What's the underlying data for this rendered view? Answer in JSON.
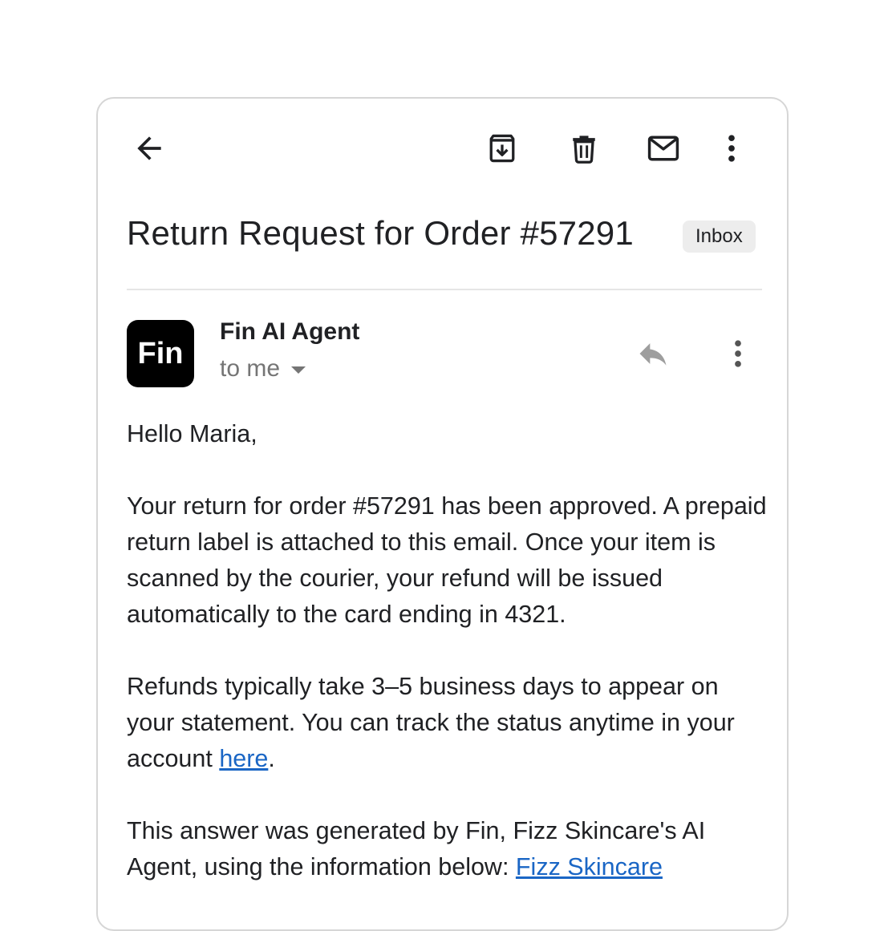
{
  "toolbar": {
    "back_icon": "back-arrow-icon",
    "archive_icon": "archive-icon",
    "delete_icon": "trash-icon",
    "mail_icon": "mail-icon",
    "more_icon": "more-vertical-icon"
  },
  "email": {
    "subject": "Return Request for Order #57291",
    "label": "Inbox",
    "sender_avatar": "Fin",
    "sender_name": "Fin AI Agent",
    "recipient": "to me",
    "greeting": "Hello Maria,",
    "para1": "Your return for order #57291 has been approved. A prepaid return label is attached to this email. Once your item is scanned by the courier, your refund will be issued automatically to the card ending in 4321.",
    "para2_text": "Refunds typically take 3–5 business days to appear on your statement. You can track the status anytime in your account ",
    "para2_link": "here",
    "para2_end": ".",
    "para3_text": "This answer was generated by Fin, Fizz Skincare's AI Agent, using the information below: ",
    "para3_link": "Fizz Skincare"
  },
  "colors": {
    "avatar_bg": "#000000",
    "link": "#1a66c5",
    "muted": "#757575",
    "badge_bg": "#ededed"
  }
}
